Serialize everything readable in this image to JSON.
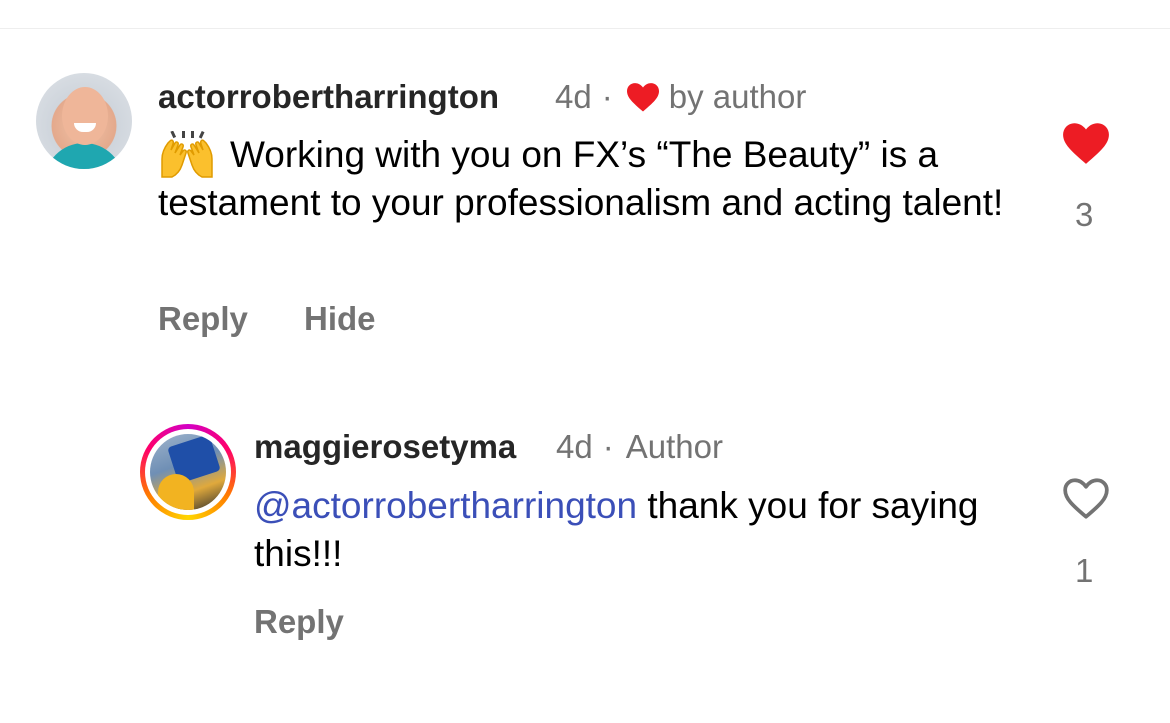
{
  "comments": [
    {
      "username": "actorrobertharrington",
      "time": "4d",
      "separator": "·",
      "badge_text": "by author",
      "emoji": "raising-hands-emoji",
      "text": "Working with you on FX’s “The Beauty” is a testament to your professionalism and acting talent!",
      "actions": {
        "reply": "Reply",
        "hide": "Hide"
      },
      "like": {
        "icon": "heart-filled-icon",
        "liked": true,
        "count": "3",
        "color": "#ed1c24"
      }
    },
    {
      "username": "maggierosetyma",
      "time": "4d",
      "separator": "·",
      "badge_text": "Author",
      "mention": "@actorrobertharrington",
      "text": " thank you for saying this!!!",
      "actions": {
        "reply": "Reply"
      },
      "like": {
        "icon": "heart-outline-icon",
        "liked": false,
        "count": "1"
      }
    }
  ],
  "colors": {
    "username": "#262626",
    "meta": "#737373",
    "mention": "#3b4fb8",
    "liked_heart": "#ed1c24"
  }
}
